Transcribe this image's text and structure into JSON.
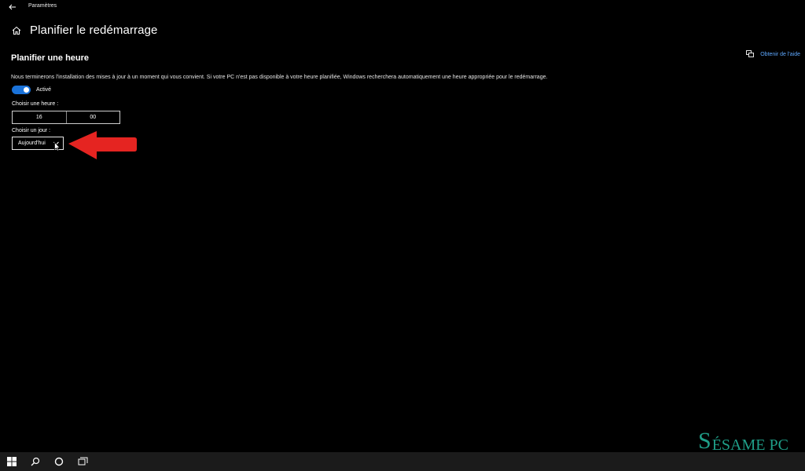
{
  "window": {
    "title": "Paramètres"
  },
  "header": {
    "title": "Planifier le redémarrage"
  },
  "section": {
    "title": "Planifier une heure"
  },
  "help": {
    "label": "Obtenir de l'aide"
  },
  "description": "Nous terminerons l'installation des mises à jour à un moment qui vous convient. Si votre PC n'est pas disponible à votre heure planifiée, Windows recherchera automatiquement une heure appropriée pour le redémarrage.",
  "toggle": {
    "state": "on",
    "label": "Activé"
  },
  "time": {
    "label": "Choisir une heure :",
    "hour": "16",
    "minute": "00"
  },
  "day": {
    "label": "Choisir un jour :",
    "value": "Aujourd'hui"
  },
  "watermark": {
    "first": "S",
    "rest": "ÉSAME PC"
  },
  "colors": {
    "accent": "#1a72d9",
    "link": "#5ea8ff",
    "annotation": "#e52421",
    "watermark": "#1f9e88"
  },
  "icons": [
    "back-arrow-icon",
    "home-icon",
    "chat-help-icon",
    "chevron-down-icon",
    "windows-start-icon",
    "search-icon",
    "cortana-icon",
    "task-view-icon"
  ]
}
